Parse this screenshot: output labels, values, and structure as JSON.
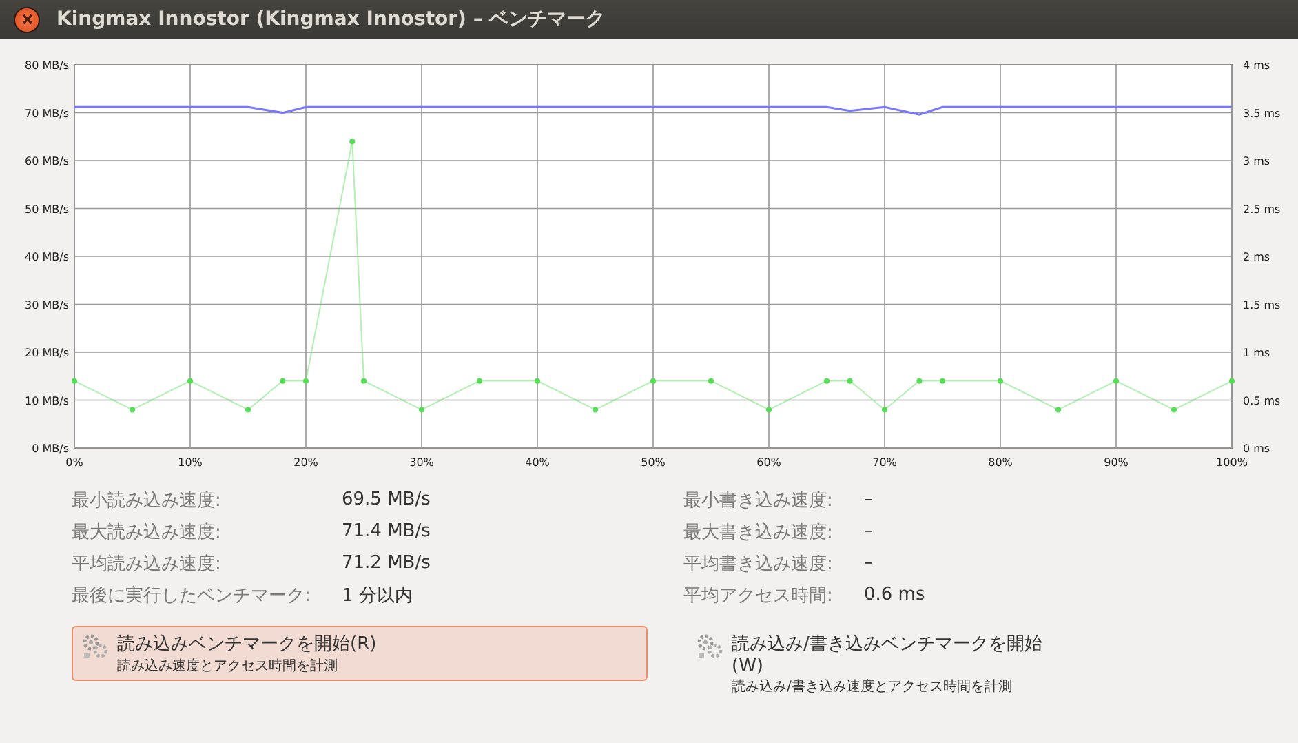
{
  "window": {
    "title": "Kingmax Innostor (Kingmax Innostor) – ベンチマーク"
  },
  "chart": {
    "chart_data": {
      "type": "line",
      "grid": true,
      "xlim": [
        0,
        100
      ],
      "ylim": [
        0,
        80
      ],
      "y2lim": [
        0,
        4
      ],
      "x": [
        0,
        5,
        10,
        15,
        18,
        20,
        24,
        25,
        30,
        35,
        40,
        45,
        50,
        55,
        60,
        65,
        67,
        70,
        73,
        75,
        80,
        85,
        90,
        95,
        100
      ],
      "xticks": [
        {
          "value": 0,
          "label": "0%"
        },
        {
          "value": 10,
          "label": "10%"
        },
        {
          "value": 20,
          "label": "20%"
        },
        {
          "value": 30,
          "label": "30%"
        },
        {
          "value": 40,
          "label": "40%"
        },
        {
          "value": 50,
          "label": "50%"
        },
        {
          "value": 60,
          "label": "60%"
        },
        {
          "value": 70,
          "label": "70%"
        },
        {
          "value": 80,
          "label": "80%"
        },
        {
          "value": 90,
          "label": "90%"
        },
        {
          "value": 100,
          "label": "100%"
        }
      ],
      "yticks": [
        {
          "value": 80,
          "label": "80 MB/s"
        },
        {
          "value": 70,
          "label": "70 MB/s"
        },
        {
          "value": 60,
          "label": "60 MB/s"
        },
        {
          "value": 50,
          "label": "50 MB/s"
        },
        {
          "value": 40,
          "label": "40 MB/s"
        },
        {
          "value": 30,
          "label": "30 MB/s"
        },
        {
          "value": 20,
          "label": "20 MB/s"
        },
        {
          "value": 10,
          "label": "10 MB/s"
        },
        {
          "value": 0,
          "label": "0 MB/s"
        }
      ],
      "y2ticks": [
        {
          "value": 4,
          "label": "4 ms"
        },
        {
          "value": 3.5,
          "label": "3.5 ms"
        },
        {
          "value": 3,
          "label": "3 ms"
        },
        {
          "value": 2.5,
          "label": "2.5 ms"
        },
        {
          "value": 2,
          "label": "2 ms"
        },
        {
          "value": 1.5,
          "label": "1.5 ms"
        },
        {
          "value": 1,
          "label": "1 ms"
        },
        {
          "value": 0.5,
          "label": "0.5 ms"
        },
        {
          "value": 0,
          "label": "0 ms"
        }
      ],
      "series": [
        {
          "color": "#7777ff",
          "values": [
            71.2,
            71.2,
            71.2,
            71.2,
            70,
            71.2,
            71.2,
            71.2,
            71.2,
            71.2,
            71.2,
            71.2,
            71.2,
            71.2,
            71.2,
            71.2,
            70.4,
            71.2,
            69.6,
            71.2,
            71.2,
            71.2,
            71.2,
            71.2,
            71.2
          ]
        },
        {
          "color": "#55dd55",
          "axis": "y2",
          "marker": "circle",
          "values": [
            0.7,
            0.4,
            0.7,
            0.4,
            0.7,
            0.7,
            3.2,
            0.7,
            0.4,
            0.7,
            0.7,
            0.4,
            0.7,
            0.7,
            0.4,
            0.7,
            0.7,
            0.4,
            0.7,
            0.7,
            0.7,
            0.4,
            0.7,
            0.4,
            0.7
          ]
        }
      ]
    }
  },
  "stats_left": [
    {
      "label": "最小読み込み速度:",
      "value": "69.5 MB/s"
    },
    {
      "label": "最大読み込み速度:",
      "value": "71.4 MB/s"
    },
    {
      "label": "平均読み込み速度:",
      "value": "71.2 MB/s"
    },
    {
      "label": "最後に実行したベンチマーク:",
      "value": "1 分以内"
    }
  ],
  "stats_right": [
    {
      "label": "最小書き込み速度:",
      "value": "–"
    },
    {
      "label": "最大書き込み速度:",
      "value": "–"
    },
    {
      "label": "平均書き込み速度:",
      "value": "–"
    },
    {
      "label": "平均アクセス時間:",
      "value": "0.6 ms"
    }
  ],
  "actions": [
    {
      "title": "読み込みベンチマークを開始(R)",
      "subtitle": "読み込み速度とアクセス時間を計測",
      "selected": true
    },
    {
      "title": "読み込み/書き込みベンチマークを開始(W)",
      "subtitle": "読み込み/書き込み速度とアクセス時間を計測",
      "selected": false
    }
  ]
}
